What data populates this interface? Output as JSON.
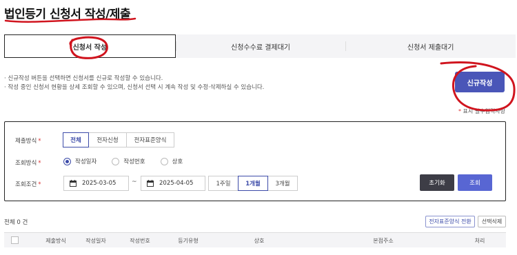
{
  "page": {
    "title": "법인등기 신청서 작성/제출"
  },
  "tabs": [
    {
      "label": "신청서 작성",
      "active": true
    },
    {
      "label": "신청수수료 결제대기",
      "active": false
    },
    {
      "label": "신청서 제출대기",
      "active": false
    }
  ],
  "notices": [
    "· 신규작성 버튼을 선택하면 신청서를 신규로 작성할 수 있습니다.",
    "· 작성 중인 신청서 현황을 상세 조회할 수 있으며, 신청서 선택 시 계속 작성 및 수정·삭제하실 수 있습니다."
  ],
  "new_button": {
    "label": "신규작성"
  },
  "required_note": {
    "star": "*",
    "text": "표시 필수입력사항"
  },
  "search": {
    "submit_method": {
      "label": "제출방식",
      "options": [
        "전체",
        "전자신청",
        "전자표준양식"
      ],
      "selected": "전체"
    },
    "query_method": {
      "label": "조회방식",
      "options": [
        "작성일자",
        "작성번호",
        "상호"
      ],
      "selected": "작성일자"
    },
    "query_condition": {
      "label": "조회조건",
      "date_from": "2025-03-05",
      "date_to": "2025-04-05",
      "tilde": "~",
      "periods": [
        "1주일",
        "1개월",
        "3개월"
      ],
      "selected_period": "1개월"
    },
    "reset_label": "초기화",
    "search_label": "조회",
    "required_star": "*"
  },
  "results": {
    "total_label": "전체",
    "total_count": "0",
    "total_unit": "건",
    "convert_button": "전자표준양식 전환",
    "delete_selected_button": "선택삭제",
    "columns": [
      "제출방식",
      "작성일자",
      "작성번호",
      "등기유형",
      "상호",
      "본점주소",
      "처리"
    ]
  },
  "colors": {
    "primary": "#4a56b8",
    "search_button": "#5866d3",
    "reset_button": "#3d3d46",
    "required_star": "#d33333",
    "annotation": "#d0141e"
  },
  "icons": {
    "calendar": "calendar-icon",
    "checkbox": "select-all-checkbox"
  }
}
